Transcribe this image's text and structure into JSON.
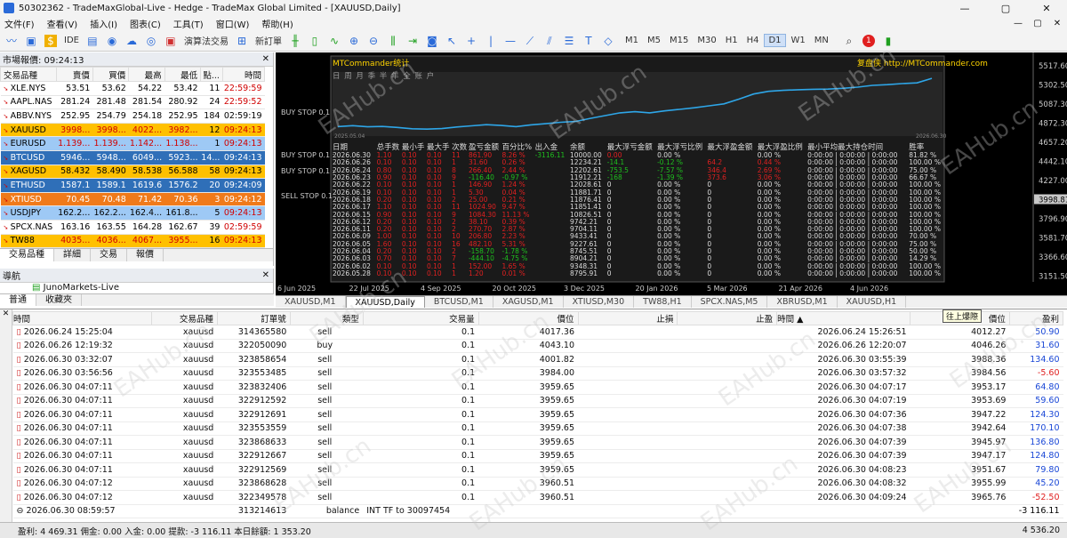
{
  "window": {
    "title": "50302362 - TradeMaxGlobal-Live - Hedge - TradeMax Global Limited - [XAUUSD,Daily]",
    "controls": [
      "—",
      "▢",
      "✕"
    ]
  },
  "menu": [
    "文件(F)",
    "查看(V)",
    "插入(I)",
    "图表(C)",
    "工具(T)",
    "窗口(W)",
    "帮助(H)"
  ],
  "toolbar": {
    "algo": "演算法交易",
    "new_order": "新訂單",
    "ide": "IDE",
    "timeframes": [
      "M1",
      "M5",
      "M15",
      "M30",
      "H1",
      "H4",
      "D1",
      "W1",
      "MN"
    ],
    "active_tf": "D1",
    "badge": "1"
  },
  "market_watch": {
    "header": "市場報價: 09:24:13",
    "columns": [
      "交易品種",
      "賣價",
      "買價",
      "最高",
      "最低",
      "點...",
      "時間"
    ],
    "rows": [
      {
        "sym": "XLE.NYS",
        "bid": "53.51",
        "ask": "53.62",
        "high": "54.22",
        "low": "53.42",
        "spread": "11",
        "time": "22:59:59",
        "bg": "#ffffff",
        "fg": "#000000",
        "tc": "#d00000"
      },
      {
        "sym": "AAPL.NAS",
        "bid": "281.24",
        "ask": "281.48",
        "high": "281.54",
        "low": "280.92",
        "spread": "24",
        "time": "22:59:52",
        "bg": "#ffffff",
        "fg": "#000000",
        "tc": "#d00000"
      },
      {
        "sym": "ABBV.NYS",
        "bid": "252.95",
        "ask": "254.79",
        "high": "254.18",
        "low": "252.95",
        "spread": "184",
        "time": "02:59:19",
        "bg": "#ffffff",
        "fg": "#000000",
        "tc": "#000000"
      },
      {
        "sym": "XAUUSD",
        "bid": "3998...",
        "ask": "3998...",
        "high": "4022...",
        "low": "3982...",
        "spread": "12",
        "time": "09:24:13",
        "bg": "#ffc000",
        "fg": "#d00000",
        "tc": "#d00000"
      },
      {
        "sym": "EURUSD",
        "bid": "1.139...",
        "ask": "1.139...",
        "high": "1.142...",
        "low": "1.138...",
        "spread": "1",
        "time": "09:24:13",
        "bg": "#9ec9f5",
        "fg": "#d00000",
        "tc": "#d00000"
      },
      {
        "sym": "BTCUSD",
        "bid": "5946...",
        "ask": "5948...",
        "high": "6049...",
        "low": "5923...",
        "spread": "14...",
        "time": "09:24:13",
        "bg": "#2f6fb8",
        "fg": "#ffffff",
        "tc": "#ffffff"
      },
      {
        "sym": "XAGUSD",
        "bid": "58.432",
        "ask": "58.490",
        "high": "58.538",
        "low": "56.588",
        "spread": "58",
        "time": "09:24:13",
        "bg": "#ffc000",
        "fg": "#000000",
        "tc": "#000000"
      },
      {
        "sym": "ETHUSD",
        "bid": "1587.1",
        "ask": "1589.1",
        "high": "1619.6",
        "low": "1576.2",
        "spread": "20",
        "time": "09:24:09",
        "bg": "#2f6fb8",
        "fg": "#ffffff",
        "tc": "#ffffff"
      },
      {
        "sym": "XTIUSD",
        "bid": "70.45",
        "ask": "70.48",
        "high": "71.42",
        "low": "70.36",
        "spread": "3",
        "time": "09:24:12",
        "bg": "#f07a1a",
        "fg": "#ffffff",
        "tc": "#ffffff"
      },
      {
        "sym": "USDJPY",
        "bid": "162.2...",
        "ask": "162.2...",
        "high": "162.4...",
        "low": "161.8...",
        "spread": "5",
        "time": "09:24:13",
        "bg": "#9ec9f5",
        "fg": "#000000",
        "tc": "#d00000"
      },
      {
        "sym": "SPCX.NAS",
        "bid": "163.16",
        "ask": "163.55",
        "high": "164.28",
        "low": "162.67",
        "spread": "39",
        "time": "02:59:59",
        "bg": "#ffffff",
        "fg": "#000000",
        "tc": "#d00000"
      },
      {
        "sym": "TW88",
        "bid": "4035...",
        "ask": "4036...",
        "high": "4067...",
        "low": "3955...",
        "spread": "16",
        "time": "09:24:13",
        "bg": "#ffc000",
        "fg": "#d00000",
        "tc": "#d00000"
      }
    ],
    "tabs": [
      "交易品種",
      "詳細",
      "交易",
      "報價"
    ]
  },
  "navigator": {
    "header": "導航",
    "item": "JunoMarkets-Live",
    "tabs": [
      "普通",
      "收藏夾"
    ]
  },
  "chart": {
    "indicator_title": "MTCommander统计",
    "url": "复盘侠 http://MTCommander.com",
    "subtitle": "日 周 月 季 半 年 全 账 户",
    "start_date": "2025.05.04",
    "end_date": "2026.06.30",
    "price_axis": [
      "5517.60",
      "5302.50",
      "5087.30",
      "4872.30",
      "4657.20",
      "4442.10",
      "4227.00",
      "3998.81",
      "3796.90",
      "3581.70",
      "3366.60",
      "3151.50"
    ],
    "current_price": "3998.81",
    "time_axis": [
      "6 Jun 2025",
      "22 Jul 2025",
      "4 Sep 2025",
      "20 Oct 2025",
      "3 Dec 2025",
      "20 Jan 2026",
      "5 Mar 2026",
      "21 Apr 2026",
      "4 Jun 2026"
    ],
    "orders": [
      "BUY STOP 0.1",
      "BUY STOP 0.1 :",
      "BUY STOP 0.1 :",
      "SELL STOP 0.1"
    ],
    "stat_headers": [
      "日期",
      "总手数",
      "最小手",
      "最大手",
      "次数",
      "盈亏金额",
      "百分比%",
      "出入金",
      "余额",
      "最大浮亏金额",
      "最大浮亏比例",
      "最大浮盈金额",
      "最大浮盈比例",
      "最小平均最大持仓时间",
      "胜率"
    ],
    "stat_rows": [
      [
        "2026.06.30",
        "1.10",
        "0.10",
        "0.10",
        "11",
        "861.90",
        "8.26 %",
        "-3116.11",
        "10000.00",
        "0.00",
        "0.00 %",
        "",
        "0.00 %",
        "0:00:00 | 0:00:00 | 0:00:00",
        "81.82 %"
      ],
      [
        "2026.06.26",
        "0.10",
        "0.10",
        "0.10",
        "1",
        "31.60",
        "0.26 %",
        "",
        "12234.21",
        "-14.1",
        "-0.12 %",
        "64.2",
        "0.44 %",
        "0:00:00 | 0:00:00 | 0:00:00",
        "100.00 %"
      ],
      [
        "2026.06.24",
        "0.80",
        "0.10",
        "0.10",
        "8",
        "266.40",
        "2.44 %",
        "",
        "12202.61",
        "-753.5",
        "-7.57 %",
        "346.4",
        "2.69 %",
        "0:00:00 | 0:00:00 | 0:00:00",
        "75.00 %"
      ],
      [
        "2026.06.23",
        "0.90",
        "0.10",
        "0.10",
        "9",
        "-116.40",
        "-0.97 %",
        "",
        "11912.21",
        "-168",
        "-1.39 %",
        "373.6",
        "3.06 %",
        "0:00:00 | 0:00:00 | 0:00:00",
        "66.67 %"
      ],
      [
        "2026.06.22",
        "0.10",
        "0.10",
        "0.10",
        "1",
        "146.90",
        "1.24 %",
        "",
        "12028.61",
        "0",
        "0.00 %",
        "0",
        "0.00 %",
        "0:00:00 | 0:00:00 | 0:00:00",
        "100.00 %"
      ],
      [
        "2026.06.19",
        "0.10",
        "0.10",
        "0.10",
        "1",
        "5.30",
        "0.04 %",
        "",
        "11881.71",
        "0",
        "0.00 %",
        "0",
        "0.00 %",
        "0:00:00 | 0:00:00 | 0:00:00",
        "100.00 %"
      ],
      [
        "2026.06.18",
        "0.20",
        "0.10",
        "0.10",
        "2",
        "25.00",
        "0.21 %",
        "",
        "11876.41",
        "0",
        "0.00 %",
        "0",
        "0.00 %",
        "0:00:00 | 0:00:00 | 0:00:00",
        "100.00 %"
      ],
      [
        "2026.06.17",
        "1.10",
        "0.10",
        "0.10",
        "11",
        "1024.90",
        "9.47 %",
        "",
        "11851.41",
        "0",
        "0.00 %",
        "0",
        "0.00 %",
        "0:00:00 | 0:00:00 | 0:00:00",
        "100.00 %"
      ],
      [
        "2026.06.15",
        "0.90",
        "0.10",
        "0.10",
        "9",
        "1084.30",
        "11.13 %",
        "",
        "10826.51",
        "0",
        "0.00 %",
        "0",
        "0.00 %",
        "0:00:00 | 0:00:00 | 0:00:00",
        "100.00 %"
      ],
      [
        "2026.06.12",
        "0.20",
        "0.10",
        "0.10",
        "2",
        "38.10",
        "0.39 %",
        "",
        "9742.21",
        "0",
        "0.00 %",
        "0",
        "0.00 %",
        "0:00:00 | 0:00:00 | 0:00:00",
        "100.00 %"
      ],
      [
        "2026.06.11",
        "0.20",
        "0.10",
        "0.10",
        "2",
        "270.70",
        "2.87 %",
        "",
        "9704.11",
        "0",
        "0.00 %",
        "0",
        "0.00 %",
        "0:00:00 | 0:00:00 | 0:00:00",
        "100.00 %"
      ],
      [
        "2026.06.09",
        "1.00",
        "0.10",
        "0.10",
        "10",
        "206.80",
        "2.23 %",
        "",
        "9433.41",
        "0",
        "0.00 %",
        "0",
        "0.00 %",
        "0:00:00 | 0:00:00 | 0:00:00",
        "70.00 %"
      ],
      [
        "2026.06.05",
        "1.60",
        "0.10",
        "0.10",
        "16",
        "482.10",
        "5.31 %",
        "",
        "9227.61",
        "0",
        "0.00 %",
        "0",
        "0.00 %",
        "0:00:00 | 0:00:00 | 0:00:00",
        "75.00 %"
      ],
      [
        "2026.06.04",
        "0.20",
        "0.10",
        "0.10",
        "2",
        "-158.70",
        "-1.78 %",
        "",
        "8745.51",
        "0",
        "0.00 %",
        "0",
        "0.00 %",
        "0:00:00 | 0:00:00 | 0:00:00",
        "50.00 %"
      ],
      [
        "2026.06.03",
        "0.70",
        "0.10",
        "0.10",
        "7",
        "-444.10",
        "-4.75 %",
        "",
        "8904.21",
        "0",
        "0.00 %",
        "0",
        "0.00 %",
        "0:00:00 | 0:00:00 | 0:00:00",
        "14.29 %"
      ],
      [
        "2026.06.02",
        "0.10",
        "0.10",
        "0.10",
        "1",
        "152.00",
        "1.65 %",
        "",
        "9348.31",
        "0",
        "0.00 %",
        "0",
        "0.00 %",
        "0:00:00 | 0:00:00 | 0:00:00",
        "100.00 %"
      ],
      [
        "2026.05.28",
        "0.10",
        "0.10",
        "0.10",
        "1",
        "1.20",
        "0.01 %",
        "",
        "8795.91",
        "0",
        "0.00 %",
        "0",
        "0.00 %",
        "0:00:00 | 0:00:00 | 0:00:00",
        "100.00 %"
      ]
    ]
  },
  "chart_tabs": [
    "XAUUSD,M1",
    "XAUUSD,Daily",
    "BTCUSD,M1",
    "XAGUSD,M1",
    "XTIUSD,M30",
    "TW88,H1",
    "SPCX.NAS,M5",
    "XBRUSD,M1",
    "XAUUSD,H1"
  ],
  "active_chart_tab": "XAUUSD,Daily",
  "trades": {
    "columns": [
      "時間",
      "交易品種",
      "訂單號",
      "類型",
      "交易量",
      "價位",
      "止損",
      "止盈",
      "時間 ▲",
      "價位",
      "盈利"
    ],
    "tooltip": "往上爆際",
    "rows": [
      [
        "2026.06.24 15:25:04",
        "xauusd",
        "314365580",
        "sell",
        "0.1",
        "4017.36",
        "",
        "",
        "2026.06.24 15:26:51",
        "4012.27",
        "50.90"
      ],
      [
        "2026.06.26 12:19:32",
        "xauusd",
        "322050090",
        "buy",
        "0.1",
        "4043.10",
        "",
        "",
        "2026.06.26 12:20:07",
        "4046.26",
        "31.60"
      ],
      [
        "2026.06.30 03:32:07",
        "xauusd",
        "323858654",
        "sell",
        "0.1",
        "4001.82",
        "",
        "",
        "2026.06.30 03:55:39",
        "3988.36",
        "134.60"
      ],
      [
        "2026.06.30 03:56:56",
        "xauusd",
        "323553485",
        "sell",
        "0.1",
        "3984.00",
        "",
        "",
        "2026.06.30 03:57:32",
        "3984.56",
        "-5.60"
      ],
      [
        "2026.06.30 04:07:11",
        "xauusd",
        "323832406",
        "sell",
        "0.1",
        "3959.65",
        "",
        "",
        "2026.06.30 04:07:17",
        "3953.17",
        "64.80"
      ],
      [
        "2026.06.30 04:07:11",
        "xauusd",
        "322912592",
        "sell",
        "0.1",
        "3959.65",
        "",
        "",
        "2026.06.30 04:07:19",
        "3953.69",
        "59.60"
      ],
      [
        "2026.06.30 04:07:11",
        "xauusd",
        "322912691",
        "sell",
        "0.1",
        "3959.65",
        "",
        "",
        "2026.06.30 04:07:36",
        "3947.22",
        "124.30"
      ],
      [
        "2026.06.30 04:07:11",
        "xauusd",
        "323553559",
        "sell",
        "0.1",
        "3959.65",
        "",
        "",
        "2026.06.30 04:07:38",
        "3942.64",
        "170.10"
      ],
      [
        "2026.06.30 04:07:11",
        "xauusd",
        "323868633",
        "sell",
        "0.1",
        "3959.65",
        "",
        "",
        "2026.06.30 04:07:39",
        "3945.97",
        "136.80"
      ],
      [
        "2026.06.30 04:07:11",
        "xauusd",
        "322912667",
        "sell",
        "0.1",
        "3959.65",
        "",
        "",
        "2026.06.30 04:07:39",
        "3947.17",
        "124.80"
      ],
      [
        "2026.06.30 04:07:11",
        "xauusd",
        "322912569",
        "sell",
        "0.1",
        "3959.65",
        "",
        "",
        "2026.06.30 04:08:23",
        "3951.67",
        "79.80"
      ],
      [
        "2026.06.30 04:07:12",
        "xauusd",
        "323868628",
        "sell",
        "0.1",
        "3960.51",
        "",
        "",
        "2026.06.30 04:08:32",
        "3955.99",
        "45.20"
      ],
      [
        "2026.06.30 04:07:12",
        "xauusd",
        "322349578",
        "sell",
        "0.1",
        "3960.51",
        "",
        "",
        "2026.06.30 04:09:24",
        "3965.76",
        "-52.50"
      ]
    ],
    "balance_row": {
      "time": "2026.06.30 08:59:57",
      "order": "313214613",
      "type": "balance",
      "comment": "INT TF to 30097454",
      "profit": "-3 116.11"
    },
    "footer": "盈利: 4 469.31  佣金: 0.00  入金: 0.00  提款: -3 116.11  本日餘額: 1 353.20",
    "total": "4 536.20"
  },
  "watermark": "EAHub.cn"
}
